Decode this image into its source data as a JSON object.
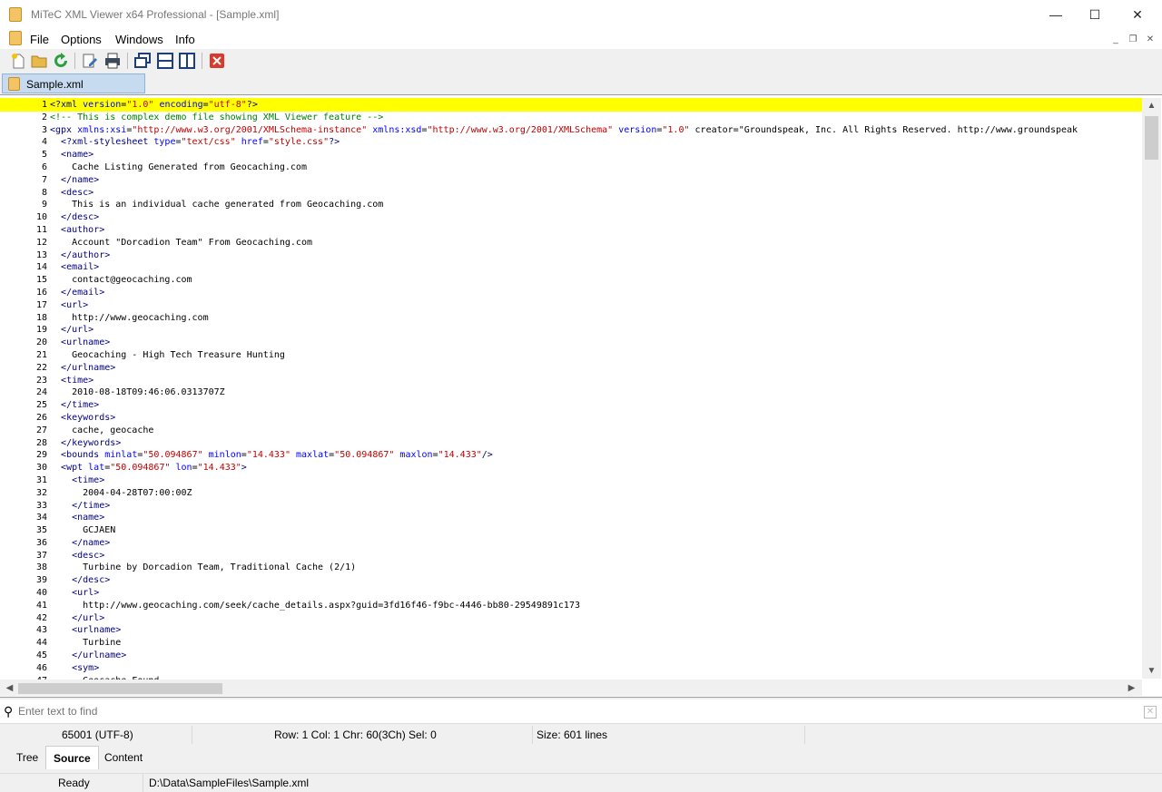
{
  "window": {
    "title": "MiTeC XML Viewer x64 Professional - [Sample.xml]",
    "minimize": "—",
    "maximize": "☐",
    "close": "✕"
  },
  "menu": {
    "file": "File",
    "options": "Options",
    "windows": "Windows",
    "info": "Info"
  },
  "mdi": {
    "min": "_",
    "restore": "❐",
    "close": "✕"
  },
  "tab": {
    "label": "Sample.xml"
  },
  "editor": {
    "line_numbers": [
      "1",
      "2",
      "3",
      "4",
      "5",
      "6",
      "7",
      "8",
      "9",
      "10",
      "11",
      "12",
      "13",
      "14",
      "15",
      "16",
      "17",
      "18",
      "19",
      "20",
      "21",
      "22",
      "23",
      "24",
      "25",
      "26",
      "27",
      "28",
      "29",
      "30",
      "31",
      "32",
      "33",
      "34",
      "35",
      "36",
      "37",
      "38",
      "39",
      "40",
      "41",
      "42",
      "43",
      "44",
      "45",
      "46",
      "47"
    ],
    "lines": [
      "<?xml version=\"1.0\" encoding=\"utf-8\"?>",
      "<!-- This is complex demo file showing XML Viewer feature -->",
      "<gpx xmlns:xsi=\"http://www.w3.org/2001/XMLSchema-instance\" xmlns:xsd=\"http://www.w3.org/2001/XMLSchema\" version=\"1.0\" creator=\"Groundspeak, Inc. All Rights Reserved. http://www.groundspeak",
      "  <?xml-stylesheet type=\"text/css\" href=\"style.css\"?>",
      "  <name>",
      "    Cache Listing Generated from Geocaching.com",
      "  </name>",
      "  <desc>",
      "    This is an individual cache generated from Geocaching.com",
      "  </desc>",
      "  <author>",
      "    Account \"Dorcadion Team\" From Geocaching.com",
      "  </author>",
      "  <email>",
      "    contact@geocaching.com",
      "  </email>",
      "  <url>",
      "    http://www.geocaching.com",
      "  </url>",
      "  <urlname>",
      "    Geocaching - High Tech Treasure Hunting",
      "  </urlname>",
      "  <time>",
      "    2010-08-18T09:46:06.0313707Z",
      "  </time>",
      "  <keywords>",
      "    cache, geocache",
      "  </keywords>",
      "  <bounds minlat=\"50.094867\" minlon=\"14.433\" maxlat=\"50.094867\" maxlon=\"14.433\"/>",
      "  <wpt lat=\"50.094867\" lon=\"14.433\">",
      "    <time>",
      "      2004-04-28T07:00:00Z",
      "    </time>",
      "    <name>",
      "      GCJAEN",
      "    </name>",
      "    <desc>",
      "      Turbine by Dorcadion Team, Traditional Cache (2/1)",
      "    </desc>",
      "    <url>",
      "      http://www.geocaching.com/seek/cache_details.aspx?guid=3fd16f46-f9bc-4446-bb80-29549891c173",
      "    </url>",
      "    <urlname>",
      "      Turbine",
      "    </urlname>",
      "    <sym>",
      "      Geocache Found"
    ]
  },
  "find": {
    "placeholder": "Enter text to find"
  },
  "status": {
    "encoding": "65001 (UTF-8)",
    "position": "Row: 1   Col: 1   Chr: 60(3Ch)   Sel: 0",
    "size": "Size: 601 lines",
    "state": "Ready",
    "path": "D:\\Data\\SampleFiles\\Sample.xml"
  },
  "view_tabs": [
    "Tree",
    "Source",
    "Content"
  ],
  "colors": {
    "highlight": "#ffff00",
    "tag": "#000080",
    "attr_name": "#0000ff",
    "attr_value": "#c00000",
    "comment": "#008000",
    "tab_bg": "#c7dbf0"
  }
}
